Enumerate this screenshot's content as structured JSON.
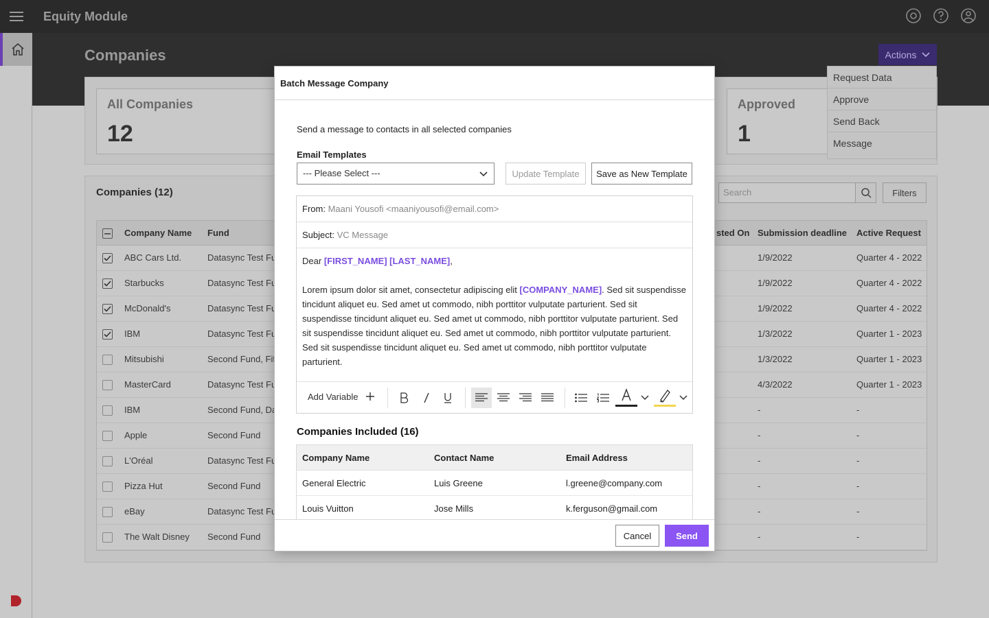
{
  "app": {
    "title": "Equity Module"
  },
  "page": {
    "title": "Companies"
  },
  "actions": {
    "label": "Actions",
    "items": [
      "Request Data",
      "Approve",
      "Send Back",
      "Message"
    ]
  },
  "stats": [
    {
      "label": "All Companies",
      "value": "12"
    },
    {
      "label": "Approved",
      "value": "1"
    }
  ],
  "table": {
    "title": "Companies (12)",
    "search_placeholder": "Search",
    "filters_label": "Filters",
    "headers": {
      "company": "Company Name",
      "fund": "Fund",
      "requested": "sted On",
      "deadline": "Submission deadline",
      "active": "Active Request"
    },
    "rows": [
      {
        "company": "ABC Cars Ltd.",
        "fund": "Datasync Test Fu",
        "deadline": "1/9/2022",
        "active": "Quarter 4 - 2022"
      },
      {
        "company": "Starbucks",
        "fund": "Datasync Test Fu",
        "deadline": "1/9/2022",
        "active": "Quarter 4 - 2022"
      },
      {
        "company": "McDonald's",
        "fund": "Datasync Test Fu",
        "deadline": "1/9/2022",
        "active": "Quarter 4 - 2022"
      },
      {
        "company": "IBM",
        "fund": "Datasync Test Fu",
        "deadline": "1/3/2022",
        "active": "Quarter 1 - 2023"
      },
      {
        "company": "Mitsubishi",
        "fund": "Second Fund, Fif",
        "deadline": "1/3/2022",
        "active": "Quarter 1 - 2023"
      },
      {
        "company": "MasterCard",
        "fund": "Datasync Test Fu",
        "deadline": "4/3/2022",
        "active": "Quarter 1 - 2023"
      },
      {
        "company": "IBM",
        "fund": "Second Fund, Da",
        "deadline": "-",
        "active": "-"
      },
      {
        "company": "Apple",
        "fund": "Second Fund",
        "deadline": "-",
        "active": "-"
      },
      {
        "company": "L'Oréal",
        "fund": "Datasync Test Fu",
        "deadline": "-",
        "active": "-"
      },
      {
        "company": "Pizza Hut",
        "fund": "Second Fund",
        "deadline": "-",
        "active": "-"
      },
      {
        "company": "eBay",
        "fund": "Datasync Test Fu",
        "deadline": "-",
        "active": "-"
      },
      {
        "company": "The Walt Disney",
        "fund": "Second Fund",
        "deadline": "-",
        "active": "-"
      }
    ]
  },
  "modal": {
    "title": "Batch Message Company",
    "intro": "Send a message to contacts in all selected companies",
    "templates_label": "Email Templates",
    "select_value": "--- Please Select ---",
    "update_template": "Update Template",
    "save_template": "Save as New Template",
    "from_label": "From:",
    "from_value": "Maani Yousofi <maaniyousofi@email.com>",
    "subject_label": "Subject:",
    "subject_value": "VC Message",
    "body": {
      "greeting": "Dear",
      "var_name": "[FIRST_NAME] [LAST_NAME]",
      "comma": ",",
      "p_start": "Lorem ipsum dolor sit amet, consectetur adipiscing elit",
      "var_company": "[COMPANY_NAME]",
      "p_rest": ". Sed sit suspendisse tincidunt aliquet eu. Sed amet ut commodo, nibh porttitor vulputate parturient. Sed sit suspendisse tincidunt aliquet eu. Sed amet ut commodo, nibh porttitor vulputate parturient. Sed sit suspendisse tincidunt aliquet eu. Sed amet ut commodo, nibh porttitor vulputate parturient. Sed sit suspendisse tincidunt aliquet eu. Sed amet ut commodo, nibh porttitor vulputate parturient."
    },
    "add_variable": "Add Variable",
    "included_title": "Companies Included (16)",
    "included_headers": {
      "company": "Company Name",
      "contact": "Contact Name",
      "email": "Email Address"
    },
    "included_rows": [
      {
        "company": "General Electric",
        "contact": "Luis Greene",
        "email": "l.greene@company.com"
      },
      {
        "company": "Louis Vuitton",
        "contact": "Jose Mills",
        "email": "k.ferguson@gmail.com"
      }
    ],
    "cancel": "Cancel",
    "send": "Send"
  },
  "colors": {
    "accent": "#8a55f2",
    "variable": "#7a4de0",
    "highlight": "#f2d64b"
  }
}
